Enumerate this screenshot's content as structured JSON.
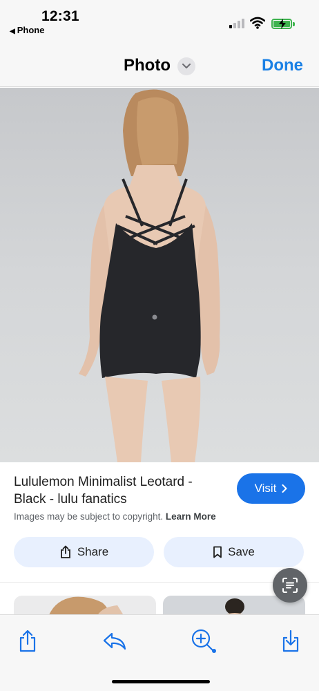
{
  "status_bar": {
    "time": "12:31",
    "back_app": "Phone",
    "battery_color": "#3fb34f"
  },
  "nav": {
    "title": "Photo",
    "done_label": "Done",
    "chevron_icon": "chevron-down-icon"
  },
  "photo": {
    "alt": "Woman wearing black strappy-back leotard"
  },
  "info": {
    "title": "Lululemon Minimalist Leotard - Black - lulu fanatics",
    "visit_label": "Visit",
    "copyright": "Images may be subject to copyright.",
    "learn_more": "Learn More",
    "share_label": "Share",
    "save_label": "Save"
  },
  "toolbar": {
    "icons": [
      "share-icon",
      "reply-icon",
      "zoom-in-icon",
      "download-icon"
    ]
  },
  "colors": {
    "accent": "#1a73e8",
    "done": "#1a80e5",
    "pill_bg": "#e8f0fe"
  }
}
